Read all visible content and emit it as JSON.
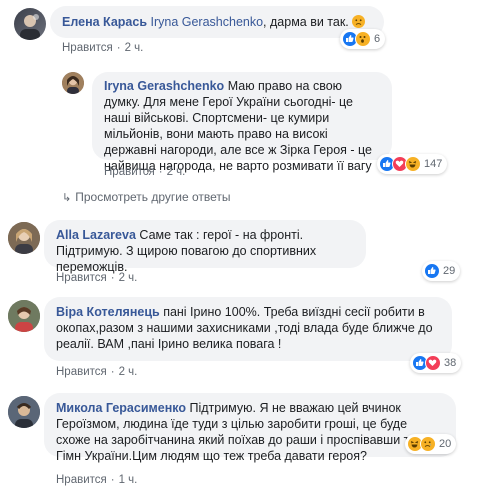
{
  "comments": [
    {
      "author": "Елена Карась",
      "mention": "Iryna Gerashchenko",
      "text": ", дарма ви так. ",
      "emoji": "☹",
      "like_label": "Нравится",
      "time": "2 ч.",
      "reaction_count": "6",
      "reactions": [
        "like",
        "wow"
      ]
    },
    {
      "author": "Iryna Gerashchenko",
      "text": "Маю право на свою думку. Для мене Герої України сьогодні- це наші військові. Спортсмени- це кумири мільйонів, вони мають право на високі державні нагороди, але все ж Зірка Героя - це найвища нагорода, не варто розмивати її вагу",
      "like_label": "Нравится",
      "time": "2 ч.",
      "reaction_count": "147",
      "reactions": [
        "like",
        "love",
        "haha"
      ]
    },
    {
      "author": "Alla Lazareva",
      "text": "Саме так : герої - на фронті. Підтримую. З щирою повагою до спортивних переможців.",
      "like_label": "Нравится",
      "time": "2 ч.",
      "reaction_count": "29",
      "reactions": [
        "like"
      ]
    },
    {
      "author": "Віра Котелянець",
      "text": "пані Ірино 100%. Треба виїздні сесії робити в окопах,разом з нашими захисниками ,тоді влада буде ближче до реалії. ВАМ ,пані Ірино велика повага !",
      "like_label": "Нравится",
      "time": "2 ч.",
      "reaction_count": "38",
      "reactions": [
        "like",
        "love"
      ]
    },
    {
      "author": "Микола Герасименко",
      "text": "Підтримую. Я не вважаю цей вчинок Героїзмом, людина їде туди з цілью заробити гроші, це буде схоже на заробітчанина який поїхав до раши і проспівавши там Гімн України.Цим людям що теж треба давати героя?",
      "like_label": "Нравится",
      "time": "1 ч.",
      "reaction_count": "20",
      "reactions": [
        "haha",
        "sad"
      ]
    }
  ],
  "more_replies": "Просмотреть другие ответы",
  "colors": {
    "link": "#385898",
    "bubble": "#f2f3f5",
    "like": "#1877f2",
    "love": "#f33e58",
    "haha": "#f7b125"
  }
}
